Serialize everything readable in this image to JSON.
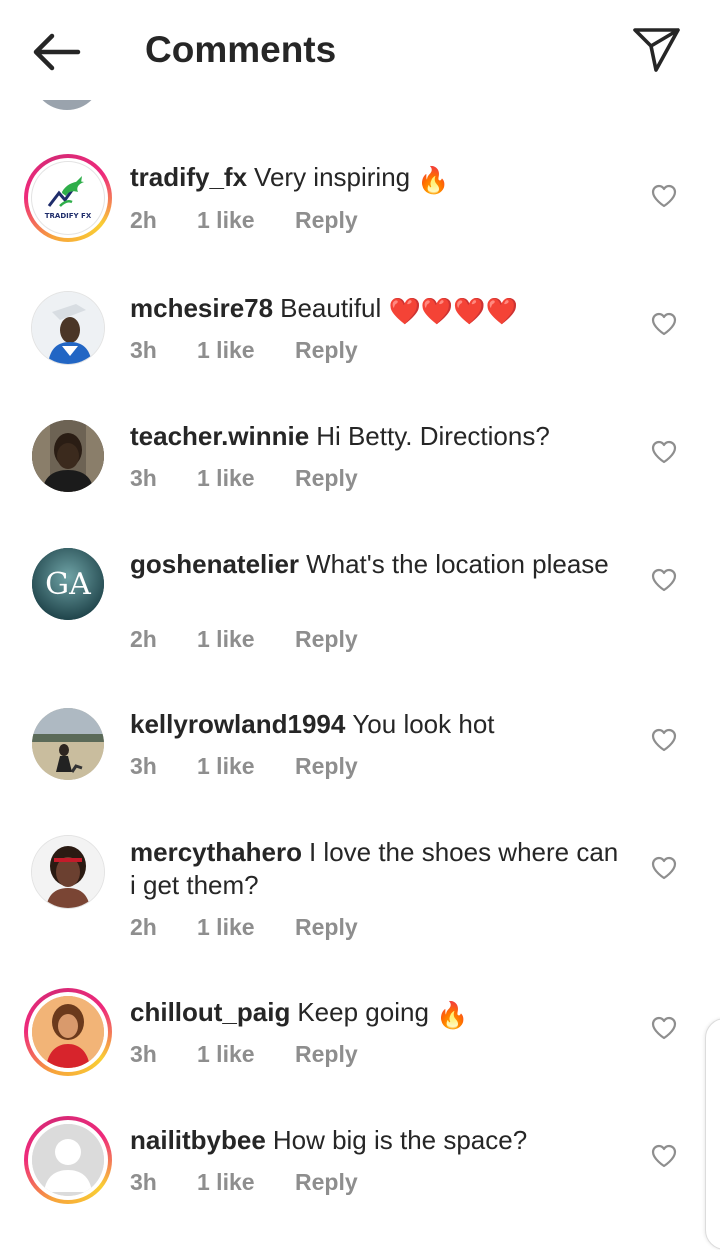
{
  "header": {
    "title": "Comments",
    "back_icon": "arrow-left-icon",
    "share_icon": "paper-plane-icon"
  },
  "comments": [
    {
      "username": "tradify_fx",
      "text": "Very inspiring",
      "emoji": "🔥",
      "time": "2h",
      "likes": "1 like",
      "reply": "Reply",
      "avatar_text": "TRADIFY FX",
      "has_story": true
    },
    {
      "username": "mchesire78",
      "text": "Beautiful",
      "emoji": "❤️❤️❤️❤️",
      "time": "3h",
      "likes": "1 like",
      "reply": "Reply",
      "has_story": false
    },
    {
      "username": "teacher.winnie",
      "text": "Hi Betty. Directions?",
      "time": "3h",
      "likes": "1 like",
      "reply": "Reply",
      "has_story": false
    },
    {
      "username": "goshenatelier",
      "text": "What's the location please",
      "time": "2h",
      "likes": "1 like",
      "reply": "Reply",
      "avatar_text": "GA",
      "has_story": false
    },
    {
      "username": "kellyrowland1994",
      "text": "You look hot",
      "time": "3h",
      "likes": "1 like",
      "reply": "Reply",
      "has_story": false
    },
    {
      "username": "mercythahero",
      "text": "I love the shoes where can i get them?",
      "time": "2h",
      "likes": "1 like",
      "reply": "Reply",
      "has_story": false
    },
    {
      "username": "chillout_paig",
      "text": "Keep going",
      "emoji": "🔥",
      "time": "3h",
      "likes": "1 like",
      "reply": "Reply",
      "has_story": true
    },
    {
      "username": "nailitbybee",
      "text": "How big is the space?",
      "time": "3h",
      "likes": "1 like",
      "reply": "Reply",
      "has_story": true
    }
  ],
  "colors": {
    "text": "#262626",
    "meta": "#8e8e8e",
    "story_ring_start": "#f7a43b",
    "story_ring_end": "#ee2a7b",
    "heart_outline": "#8e8e8e"
  }
}
